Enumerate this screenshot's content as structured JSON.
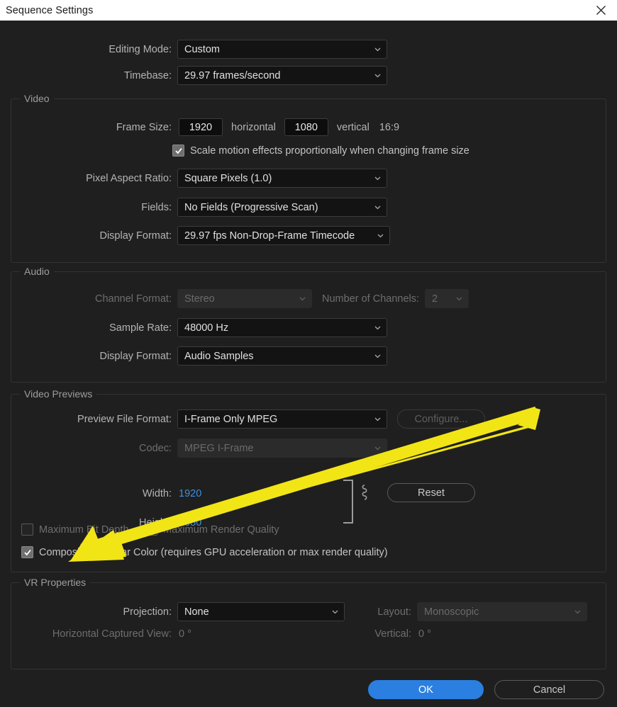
{
  "window": {
    "title": "Sequence Settings",
    "close_icon": "close-icon"
  },
  "top": {
    "editing_mode_label": "Editing Mode:",
    "editing_mode_value": "Custom",
    "timebase_label": "Timebase:",
    "timebase_value": "29.97  frames/second"
  },
  "video": {
    "group_title": "Video",
    "frame_size_label": "Frame Size:",
    "frame_width": "1920",
    "horizontal_label": "horizontal",
    "frame_height": "1080",
    "vertical_label": "vertical",
    "aspect_ratio_text": "16:9",
    "scale_motion_label": "Scale motion effects proportionally when changing frame size",
    "scale_motion_checked": true,
    "pixel_aspect_label": "Pixel Aspect Ratio:",
    "pixel_aspect_value": "Square Pixels (1.0)",
    "fields_label": "Fields:",
    "fields_value": "No Fields (Progressive Scan)",
    "display_format_label": "Display Format:",
    "display_format_value": "29.97 fps Non-Drop-Frame Timecode"
  },
  "audio": {
    "group_title": "Audio",
    "channel_format_label": "Channel Format:",
    "channel_format_value": "Stereo",
    "number_of_channels_label": "Number of Channels:",
    "number_of_channels_value": "2",
    "sample_rate_label": "Sample Rate:",
    "sample_rate_value": "48000 Hz",
    "display_format_label": "Display Format:",
    "display_format_value": "Audio Samples"
  },
  "video_previews": {
    "group_title": "Video Previews",
    "preview_file_format_label": "Preview File Format:",
    "preview_file_format_value": "I-Frame Only MPEG",
    "configure_label": "Configure...",
    "codec_label": "Codec:",
    "codec_value": "MPEG I-Frame",
    "width_label": "Width:",
    "width_value": "1920",
    "height_label": "Height:",
    "height_value": "1080",
    "reset_label": "Reset",
    "max_bit_depth_label": "Maximum Bit Depth",
    "max_bit_depth_checked": false,
    "max_render_quality_label": "Maximum Render Quality",
    "max_render_quality_checked": false,
    "composite_linear_label": "Composite in Linear Color (requires GPU acceleration or max render quality)",
    "composite_linear_checked": true
  },
  "vr": {
    "group_title": "VR Properties",
    "projection_label": "Projection:",
    "projection_value": "None",
    "layout_label": "Layout:",
    "layout_value": "Monoscopic",
    "horizontal_captured_label": "Horizontal Captured View:",
    "horizontal_captured_value": "0 °",
    "vertical_label": "Vertical:",
    "vertical_value": "0 °"
  },
  "footer": {
    "ok_label": "OK",
    "cancel_label": "Cancel"
  },
  "annotation": {
    "arrow_color": "#f2e516"
  },
  "colors": {
    "accent_blue": "#2a7fe0",
    "value_blue": "#3f8fdd",
    "panel_bg": "#1f1f1f",
    "titlebar_bg": "#ffffff",
    "highlight_yellow": "#f2e516"
  }
}
